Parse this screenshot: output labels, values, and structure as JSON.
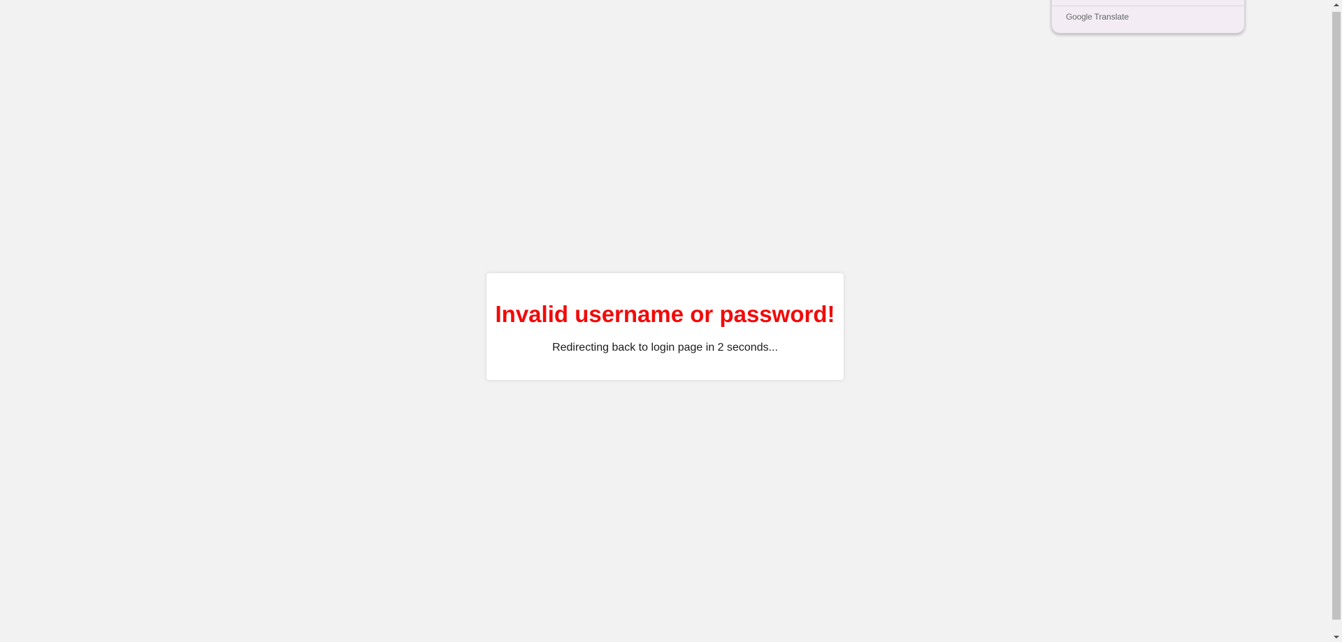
{
  "translate_popup": {
    "brand_google": "Google",
    "brand_translate": "Translate"
  },
  "message": {
    "title": "Invalid username or password!",
    "subtitle": "Redirecting back to login page in 2 seconds..."
  },
  "colors": {
    "background": "#f2f2f2",
    "error_title": "#f20a0a",
    "card": "#ffffff"
  }
}
